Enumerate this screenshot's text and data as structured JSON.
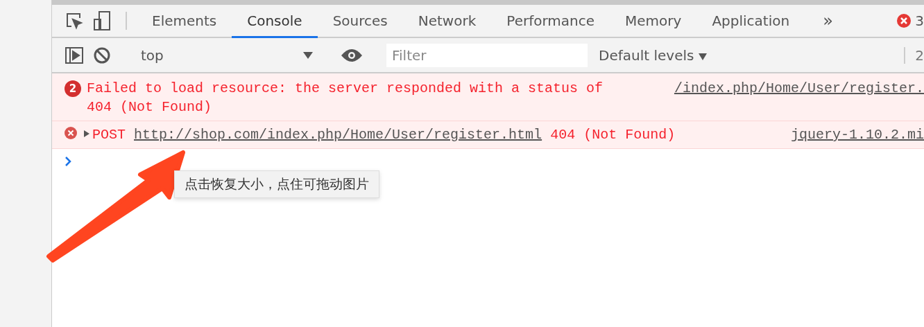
{
  "tabs": [
    {
      "label": "Elements",
      "selected": false
    },
    {
      "label": "Console",
      "selected": true
    },
    {
      "label": "Sources",
      "selected": false
    },
    {
      "label": "Network",
      "selected": false
    },
    {
      "label": "Performance",
      "selected": false
    },
    {
      "label": "Memory",
      "selected": false
    },
    {
      "label": "Application",
      "selected": false
    }
  ],
  "more_tabs": "»",
  "error_count": "3",
  "toolbar": {
    "context": "top",
    "filter": {
      "placeholder": "Filter"
    },
    "levels": "Default levels",
    "hidden_count": "2"
  },
  "messages": [
    {
      "badge": "2",
      "text": "Failed to load resource: the server responded with a status of 404 (Not Found)",
      "source": "/index.php/Home/User/register."
    },
    {
      "method": "POST",
      "url": "http://shop.com/index.php/Home/User/register.html",
      "status": "404 (Not Found)",
      "source": "jquery-1.10.2.mi"
    }
  ],
  "tooltip": "点击恢复大小，点住可拖动图片"
}
